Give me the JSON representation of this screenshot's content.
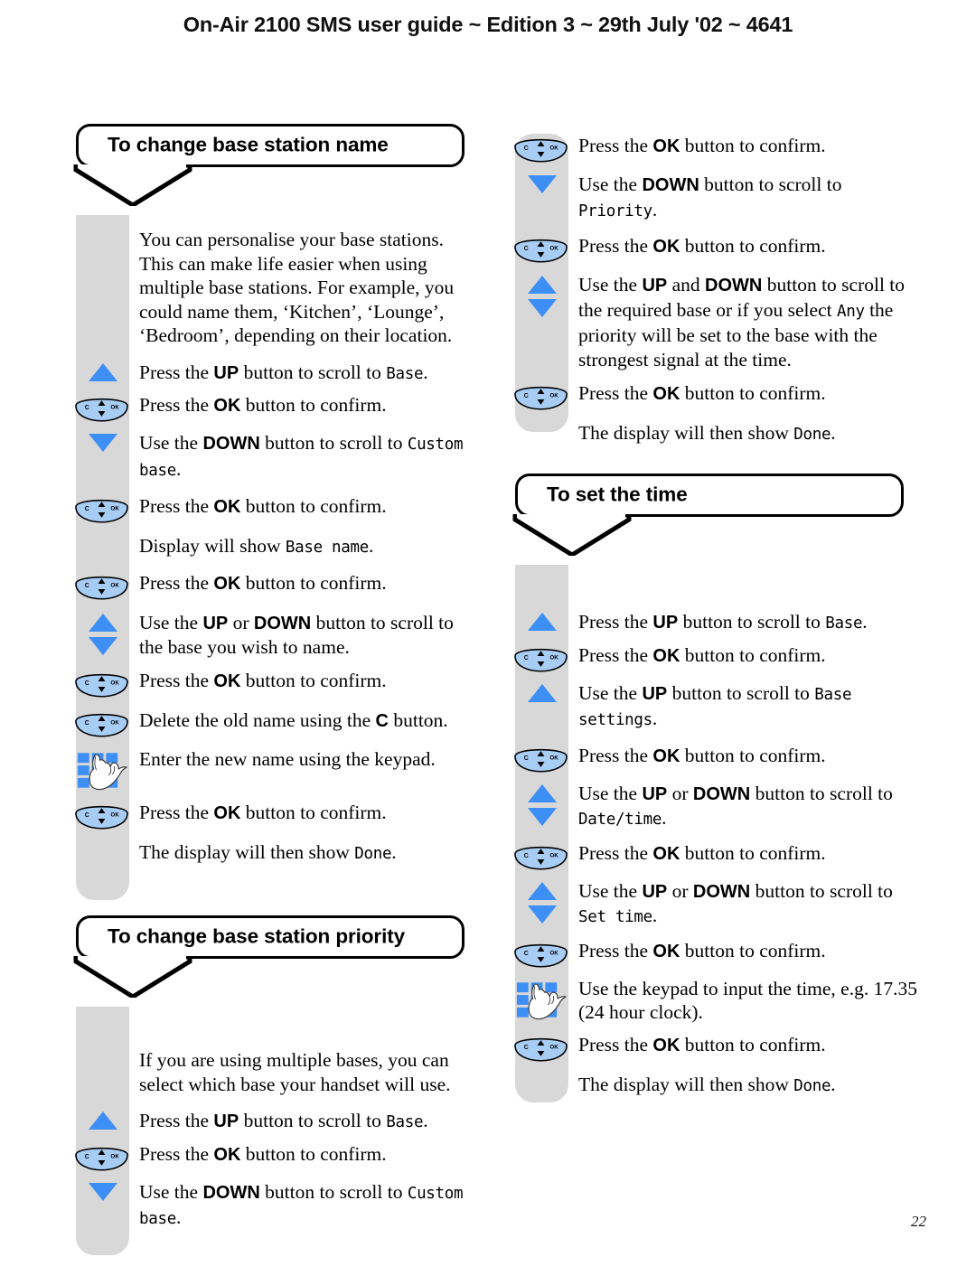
{
  "page": {
    "header": "On-Air 2100 SMS user guide ~ Edition 3 ~ 29th July '02 ~ 4641",
    "number": "22",
    "colors": {
      "rail_grey": "#d8d8d8",
      "button_blue": "#3d8ef5",
      "ok_button_fill": "#a8cdf5",
      "text_black": "#000000"
    }
  },
  "sections": {
    "change_base_station_name": {
      "title": "To change base station name",
      "intro": "You can personalise your base stations. This can make life easier when using multiple base stations.  For example, you could name them, ‘Kitchen’, ‘Lounge’, ‘Bedroom’, depending on their location.",
      "steps": [
        {
          "icon": "up-arrow-icon",
          "text_1": "Press the ",
          "bold_1": "UP",
          "text_2": " button to scroll to ",
          "lcd_1": "Base",
          "text_3": "."
        },
        {
          "icon": "ok-button-icon",
          "text_1": "Press the ",
          "bold_1": "OK",
          "text_2": " button to confirm.",
          "lcd_1": "",
          "text_3": ""
        },
        {
          "icon": "down-arrow-icon",
          "text_1": "Use the ",
          "bold_1": "DOWN",
          "text_2": " button to scroll to ",
          "lcd_1": "Custom base",
          "text_3": "."
        },
        {
          "icon": "ok-button-icon",
          "text_1": "Press the ",
          "bold_1": "OK",
          "text_2": " button to confirm.",
          "lcd_1": "",
          "text_3": ""
        },
        {
          "icon": "none",
          "text_1": "Display will show ",
          "bold_1": "",
          "text_2": "",
          "lcd_1": "Base name",
          "text_3": "."
        },
        {
          "icon": "ok-button-icon",
          "text_1": "Press the ",
          "bold_1": "OK",
          "text_2": " button to confirm.",
          "lcd_1": "",
          "text_3": ""
        },
        {
          "icon": "up-down-arrow-icon",
          "text_1": "Use the ",
          "bold_1": "UP",
          "text_2": " or ",
          "bold_2": "DOWN",
          "text_3": " button to scroll to the base you wish to name.",
          "lcd_1": ""
        },
        {
          "icon": "ok-button-icon",
          "text_1": "Press the ",
          "bold_1": "OK",
          "text_2": " button to confirm.",
          "lcd_1": "",
          "text_3": ""
        },
        {
          "icon": "ok-button-icon",
          "text_1": "Delete the old name using the ",
          "bold_1": "C",
          "text_2": " button.",
          "lcd_1": "",
          "text_3": ""
        },
        {
          "icon": "keypad-icon",
          "text_1": "Enter the new name using the keypad.",
          "bold_1": "",
          "text_2": "",
          "lcd_1": "",
          "text_3": ""
        },
        {
          "icon": "ok-button-icon",
          "text_1": "Press the ",
          "bold_1": "OK",
          "text_2": " button to confirm.",
          "lcd_1": "",
          "text_3": ""
        },
        {
          "icon": "none",
          "text_1": "The display will then show ",
          "bold_1": "",
          "text_2": "",
          "lcd_1": "Done",
          "text_3": "."
        }
      ]
    },
    "change_base_station_priority": {
      "title": "To change base station priority",
      "intro": "If you are using multiple bases, you can select which base your handset will use.",
      "steps_left": [
        {
          "icon": "up-arrow-icon",
          "text_1": "Press the ",
          "bold_1": "UP",
          "text_2": " button to scroll to ",
          "lcd_1": "Base",
          "text_3": "."
        },
        {
          "icon": "ok-button-icon",
          "text_1": "Press the ",
          "bold_1": "OK",
          "text_2": " button to confirm.",
          "lcd_1": "",
          "text_3": ""
        },
        {
          "icon": "down-arrow-icon",
          "text_1": "Use the ",
          "bold_1": "DOWN",
          "text_2": " button to scroll to ",
          "lcd_1": "Custom base",
          "text_3": "."
        }
      ],
      "steps_right": [
        {
          "icon": "ok-button-icon",
          "text_1": "Press the ",
          "bold_1": "OK",
          "text_2": " button to confirm.",
          "lcd_1": "",
          "text_3": ""
        },
        {
          "icon": "down-arrow-icon",
          "text_1": "Use the ",
          "bold_1": "DOWN",
          "text_2": " button to scroll to ",
          "lcd_1": "Priority",
          "text_3": "."
        },
        {
          "icon": "ok-button-icon",
          "text_1": "Press the ",
          "bold_1": "OK",
          "text_2": " button to confirm.",
          "lcd_1": "",
          "text_3": ""
        },
        {
          "icon": "up-down-arrow-icon",
          "text_1": "Use the ",
          "bold_1": "UP",
          "text_2": " and ",
          "bold_2": "DOWN",
          "text_3": " button to scroll to the required base or if you select ",
          "lcd_1": "Any",
          "text_4": " the priority will be set to the base with the strongest signal at the time."
        },
        {
          "icon": "ok-button-icon",
          "text_1": "Press the ",
          "bold_1": "OK",
          "text_2": " button to confirm.",
          "lcd_1": "",
          "text_3": ""
        },
        {
          "icon": "none",
          "text_1": "The display will then show ",
          "bold_1": "",
          "text_2": "",
          "lcd_1": "Done",
          "text_3": "."
        }
      ]
    },
    "set_the_time": {
      "title": "To set the time",
      "steps": [
        {
          "icon": "up-arrow-icon",
          "text_1": "Press the ",
          "bold_1": "UP",
          "text_2": " button to scroll to ",
          "lcd_1": "Base",
          "text_3": "."
        },
        {
          "icon": "ok-button-icon",
          "text_1": "Press the ",
          "bold_1": "OK",
          "text_2": " button to confirm.",
          "lcd_1": "",
          "text_3": ""
        },
        {
          "icon": "up-arrow-icon",
          "text_1": "Use the ",
          "bold_1": "UP",
          "text_2": " button to scroll to ",
          "lcd_1": "Base settings",
          "text_3": "."
        },
        {
          "icon": "ok-button-icon",
          "text_1": "Press the ",
          "bold_1": "OK",
          "text_2": " button to confirm.",
          "lcd_1": "",
          "text_3": ""
        },
        {
          "icon": "up-down-arrow-icon",
          "text_1": "Use the ",
          "bold_1": "UP",
          "text_2": " or ",
          "bold_2": "DOWN",
          "text_3": " button to scroll to ",
          "lcd_1": "Date/time",
          "text_4": "."
        },
        {
          "icon": "ok-button-icon",
          "text_1": "Press the ",
          "bold_1": "OK",
          "text_2": " button to confirm.",
          "lcd_1": "",
          "text_3": ""
        },
        {
          "icon": "up-down-arrow-icon",
          "text_1": "Use the ",
          "bold_1": "UP",
          "text_2": " or ",
          "bold_2": "DOWN",
          "text_3": " button to scroll to ",
          "lcd_1": "Set time",
          "text_4": "."
        },
        {
          "icon": "ok-button-icon",
          "text_1": "Press the ",
          "bold_1": "OK",
          "text_2": " button to confirm.",
          "lcd_1": "",
          "text_3": ""
        },
        {
          "icon": "keypad-icon",
          "text_1": "Use the keypad to input the time, e.g. 17.35 (24 hour clock).",
          "bold_1": "",
          "text_2": "",
          "lcd_1": "",
          "text_3": ""
        },
        {
          "icon": "ok-button-icon",
          "text_1": "Press the ",
          "bold_1": "OK",
          "text_2": " button to confirm.",
          "lcd_1": "",
          "text_3": ""
        },
        {
          "icon": "none",
          "text_1": "The display will then show ",
          "bold_1": "",
          "text_2": "",
          "lcd_1": "Done",
          "text_3": "."
        }
      ]
    }
  },
  "icons": {
    "up-arrow-icon": "▲",
    "down-arrow-icon": "▼",
    "up-down-arrow-icon": "▲▼",
    "ok-button-icon": "C / OK navigation key",
    "keypad-icon": "3x3 keypad with pointing hand"
  }
}
